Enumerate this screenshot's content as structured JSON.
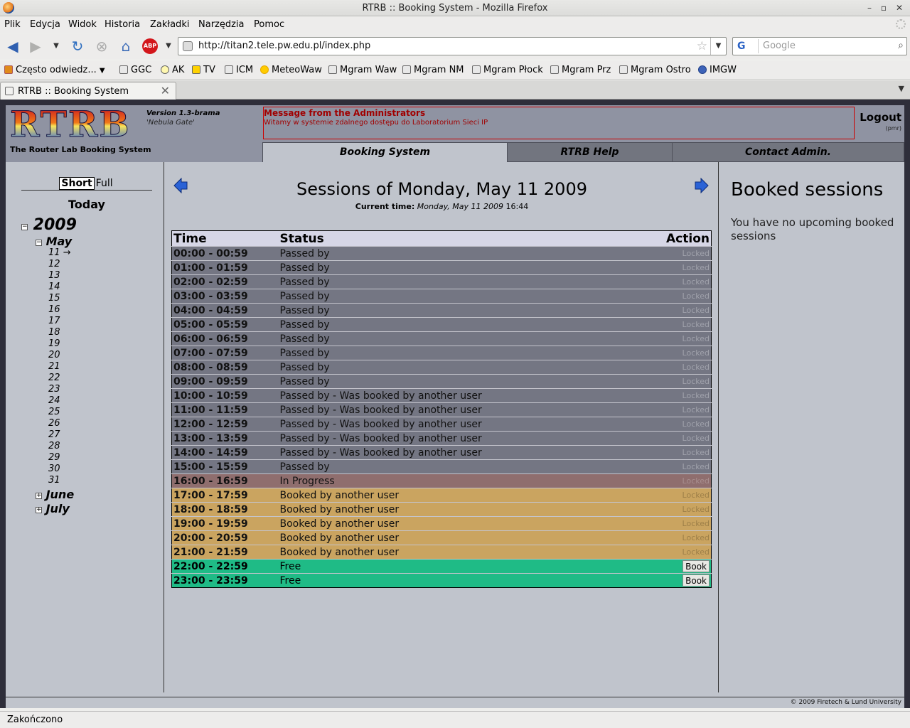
{
  "window": {
    "title": "RTRB :: Booking System - Mozilla Firefox",
    "buttons": [
      "✕",
      "▫",
      "▢"
    ]
  },
  "menu": [
    "Plik",
    "Edycja",
    "Widok",
    "Historia",
    "Zakładki",
    "Narzędzia",
    "Pomoc"
  ],
  "navigation": {
    "url": "http://titan2.tele.pw.edu.pl/index.php",
    "search_placeholder": "Google",
    "search_engine": "G",
    "adblock_label": "ABP"
  },
  "bookmarks": [
    "Często odwiedz...",
    "GGC",
    "AK",
    "TV",
    "ICM",
    "MeteoWaw",
    "Mgram Waw",
    "Mgram NM",
    "Mgram Płock",
    "Mgram Prz",
    "Mgram Ostro",
    "IMGW"
  ],
  "tab": {
    "label": "RTRB :: Booking System"
  },
  "header": {
    "logo": "RTRB",
    "tagline": "The Router Lab Booking System",
    "version": "Version 1.3-brama",
    "codename": "'Nebula Gate'",
    "admin_title": "Message from the Administrators",
    "admin_body": "Witamy w systemie zdalnego dostępu do Laboratorium Sieci IP",
    "logout": "Logout",
    "user": "(pmr)",
    "tabs": [
      "Booking System",
      "RTRB Help",
      "Contact Admin."
    ]
  },
  "calendar": {
    "mode_short": "Short",
    "mode_full": "Full",
    "today": "Today",
    "year": "2009",
    "may": "May",
    "current_day": "11",
    "current_marker": "→",
    "days": [
      "12",
      "13",
      "14",
      "15",
      "16",
      "17",
      "18",
      "19",
      "20",
      "21",
      "22",
      "23",
      "24",
      "25",
      "26",
      "27",
      "28",
      "29",
      "30",
      "31"
    ],
    "june": "June",
    "july": "July"
  },
  "sessions": {
    "title": "Sessions of Monday, May 11 2009",
    "current_time_label": "Current time:",
    "current_time_value": "Monday,  May 11 2009",
    "current_time_clock": "16:44",
    "columns": {
      "time": "Time",
      "status": "Status",
      "action": "Action"
    },
    "rows": [
      {
        "time": "00:00 - 00:59",
        "status": "Passed by",
        "action": "Locked",
        "state": "passed"
      },
      {
        "time": "01:00 - 01:59",
        "status": "Passed by",
        "action": "Locked",
        "state": "passed"
      },
      {
        "time": "02:00 - 02:59",
        "status": "Passed by",
        "action": "Locked",
        "state": "passed"
      },
      {
        "time": "03:00 - 03:59",
        "status": "Passed by",
        "action": "Locked",
        "state": "passed"
      },
      {
        "time": "04:00 - 04:59",
        "status": "Passed by",
        "action": "Locked",
        "state": "passed"
      },
      {
        "time": "05:00 - 05:59",
        "status": "Passed by",
        "action": "Locked",
        "state": "passed"
      },
      {
        "time": "06:00 - 06:59",
        "status": "Passed by",
        "action": "Locked",
        "state": "passed"
      },
      {
        "time": "07:00 - 07:59",
        "status": "Passed by",
        "action": "Locked",
        "state": "passed"
      },
      {
        "time": "08:00 - 08:59",
        "status": "Passed by",
        "action": "Locked",
        "state": "passed"
      },
      {
        "time": "09:00 - 09:59",
        "status": "Passed by",
        "action": "Locked",
        "state": "passed"
      },
      {
        "time": "10:00 - 10:59",
        "status": "Passed by - Was booked by another user",
        "action": "Locked",
        "state": "passed"
      },
      {
        "time": "11:00 - 11:59",
        "status": "Passed by - Was booked by another user",
        "action": "Locked",
        "state": "passed"
      },
      {
        "time": "12:00 - 12:59",
        "status": "Passed by - Was booked by another user",
        "action": "Locked",
        "state": "passed"
      },
      {
        "time": "13:00 - 13:59",
        "status": "Passed by - Was booked by another user",
        "action": "Locked",
        "state": "passed"
      },
      {
        "time": "14:00 - 14:59",
        "status": "Passed by - Was booked by another user",
        "action": "Locked",
        "state": "passed"
      },
      {
        "time": "15:00 - 15:59",
        "status": "Passed by",
        "action": "Locked",
        "state": "passed"
      },
      {
        "time": "16:00 - 16:59",
        "status": "In Progress",
        "action": "Locked",
        "state": "progress"
      },
      {
        "time": "17:00 - 17:59",
        "status": "Booked by another user",
        "action": "Locked",
        "state": "booked"
      },
      {
        "time": "18:00 - 18:59",
        "status": "Booked by another user",
        "action": "Locked",
        "state": "booked"
      },
      {
        "time": "19:00 - 19:59",
        "status": "Booked by another user",
        "action": "Locked",
        "state": "booked"
      },
      {
        "time": "20:00 - 20:59",
        "status": "Booked by another user",
        "action": "Locked",
        "state": "booked"
      },
      {
        "time": "21:00 - 21:59",
        "status": "Booked by another user",
        "action": "Locked",
        "state": "booked"
      },
      {
        "time": "22:00 - 22:59",
        "status": "Free",
        "action": "Book",
        "state": "free"
      },
      {
        "time": "23:00 - 23:59",
        "status": "Free",
        "action": "Book",
        "state": "free"
      }
    ]
  },
  "booked": {
    "title": "Booked sessions",
    "text": "You have no upcoming booked sessions"
  },
  "footer": "© 2009 Firetech & Lund University",
  "status": "Zakończono",
  "colors": {
    "passed": "#747683",
    "in_progress": "#8f6e6e",
    "booked": "#caa460",
    "free": "#1fbb86",
    "page_bg": "#c0c4cc",
    "header_bg": "#8f93a2"
  }
}
